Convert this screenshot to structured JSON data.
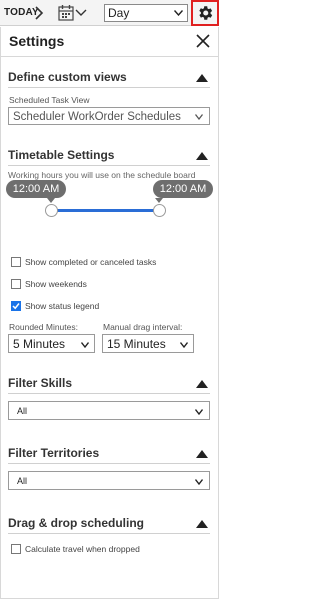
{
  "toolbar": {
    "today_label": "TODAY",
    "view_select_value": "Day"
  },
  "panel": {
    "title": "Settings"
  },
  "custom_views": {
    "heading": "Define custom views",
    "field_label": "Scheduled Task View",
    "field_value": "Scheduler WorkOrder Schedules"
  },
  "timetable": {
    "heading": "Timetable Settings",
    "description": "Working hours you will use on the schedule board view",
    "start_time": "12:00 AM",
    "end_time": "12:00 AM",
    "checkboxes": [
      {
        "label": "Show completed or canceled tasks",
        "checked": false
      },
      {
        "label": "Show weekends",
        "checked": false
      },
      {
        "label": "Show status legend",
        "checked": true
      }
    ],
    "rounded_minutes_label": "Rounded Minutes:",
    "rounded_minutes_value": "5 Minutes",
    "drag_interval_label": "Manual drag interval:",
    "drag_interval_value": "15 Minutes"
  },
  "filter_skills": {
    "heading": "Filter Skills",
    "value": "All"
  },
  "filter_territories": {
    "heading": "Filter Territories",
    "value": "All"
  },
  "drag_drop": {
    "heading": "Drag & drop scheduling",
    "checkbox_label": "Calculate travel when dropped",
    "checked": false
  },
  "colors": {
    "accent": "#2a6dd6",
    "checkbox_checked": "#1a73e8",
    "time_pill": "#6e6e6e",
    "highlight_border": "#e02020"
  }
}
